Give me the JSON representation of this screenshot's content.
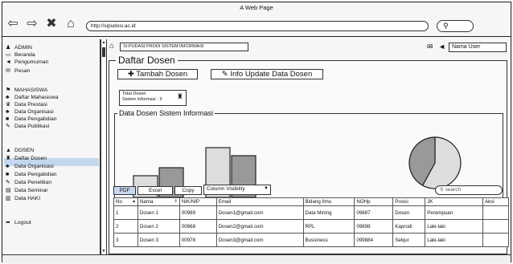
{
  "window": {
    "title": "A Web Page",
    "url": "http://sipudosi.ac.id"
  },
  "icons": {
    "back": "arrow-left-icon",
    "forward": "arrow-right-icon",
    "close": "close-icon",
    "home": "home-icon",
    "search": "search-icon",
    "mail": "mail-icon",
    "megaphone": "megaphone-icon"
  },
  "sidebar": {
    "items": [
      {
        "label": "ADMIN",
        "icon": "user-icon",
        "glyph": "♟"
      },
      {
        "label": "Beranda",
        "icon": "laptop-icon",
        "glyph": "▭"
      },
      {
        "label": "Pengumuman",
        "icon": "megaphone-icon",
        "glyph": "◄"
      },
      {
        "label": "Pesan",
        "icon": "mail-icon",
        "glyph": "✉"
      },
      {
        "label": "MAHASISWA",
        "icon": "graduation-icon",
        "glyph": "⚑"
      },
      {
        "label": "Daftar Mahasiswa",
        "icon": "users-icon",
        "glyph": "♣"
      },
      {
        "label": "Data Prestasi",
        "icon": "trophy-icon",
        "glyph": "♛"
      },
      {
        "label": "Data Organisasi",
        "icon": "group-icon",
        "glyph": "♣"
      },
      {
        "label": "Data Pengabdian",
        "icon": "briefcase-icon",
        "glyph": "■"
      },
      {
        "label": "Data Publikasi",
        "icon": "pen-icon",
        "glyph": "✎"
      },
      {
        "label": "DOSEN",
        "icon": "lock-icon",
        "glyph": "▲"
      },
      {
        "label": "Daftar Dosen",
        "icon": "teacher-icon",
        "glyph": "♜"
      },
      {
        "label": "Data Organisasi",
        "icon": "group-icon",
        "glyph": "♣"
      },
      {
        "label": "Data Pengabdian",
        "icon": "briefcase-icon",
        "glyph": "■"
      },
      {
        "label": "Data Penelitian",
        "icon": "pencil-icon",
        "glyph": "✎"
      },
      {
        "label": "Data Seminar",
        "icon": "presentation-icon",
        "glyph": "▤"
      },
      {
        "label": "Data HAKI",
        "icon": "book-icon",
        "glyph": "▥"
      },
      {
        "label": "Logout",
        "icon": "logout-icon",
        "glyph": "➥"
      }
    ]
  },
  "header": {
    "breadcrumb": "SI-PUDASI PRODI SISTEM INFORMASI",
    "user": "Nama User"
  },
  "main": {
    "title": "Daftar Dosen",
    "add_button": "Tambah Dosen",
    "update_button": "Info Update Data Dosen",
    "info_line1": "Total Dosen",
    "info_line2": "Sistem Informasi : 3",
    "chart_title": "Data Dosen Sistem Informasi"
  },
  "chart_data": [
    {
      "type": "bar",
      "categories": [
        "",
        "",
        "",
        ""
      ],
      "values": [
        27,
        37,
        62,
        52
      ],
      "ylim": [
        0,
        100
      ],
      "colors": [
        "#dddddd",
        "#999999",
        "#dddddd",
        "#999999"
      ],
      "title": "",
      "xlabel": "",
      "ylabel": ""
    },
    {
      "type": "pie",
      "values": [
        58,
        42
      ],
      "colors": [
        "#dddddd",
        "#999999"
      ],
      "title": ""
    }
  ],
  "table_tools": {
    "buttons": [
      "PDF",
      "Excel",
      "Copy"
    ],
    "column_visibility": "Column Visibility",
    "search_placeholder": "search"
  },
  "table": {
    "columns": [
      "No",
      "Nama",
      "NIK/NIP",
      "Email",
      "Bidang Ilmu",
      "NOHp",
      "Posisi",
      "JK",
      "Aksi"
    ],
    "rows": [
      [
        "1",
        "Dosen 1",
        "00989",
        "Dosen1@gmail.com",
        "Data Mining",
        "09887",
        "Dosen",
        "Perempuan",
        ""
      ],
      [
        "2",
        "Dosen 2",
        "00868",
        "Dosen2@gmail.com",
        "RPL",
        "09898",
        "Kaprodi",
        "Laki-laki",
        ""
      ],
      [
        "3",
        "Dosen 3",
        "00978",
        "Dosen3@gmail.com",
        "Bussiness",
        "099884",
        "Sekjur",
        "Laki-laki",
        ""
      ]
    ]
  }
}
